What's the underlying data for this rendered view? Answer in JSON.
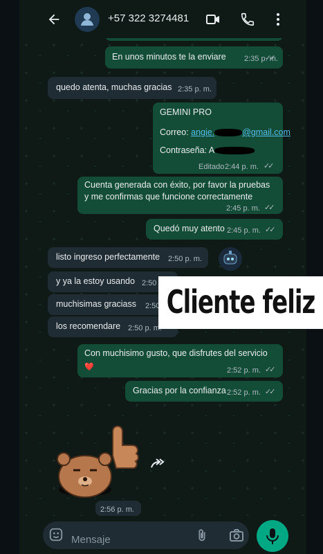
{
  "header": {
    "contact": "+57 322 3274481"
  },
  "messages": [
    {
      "text": "En unos minutos te la enviare",
      "time": "2:35 p. m."
    },
    {
      "text": "quedo atenta, muchas gracias",
      "time": "2:35 p. m."
    },
    {
      "title": "GEMINI PRO",
      "email_label": "Correo: ",
      "email_value": "angie.",
      "email_suffix": "@gmail.com",
      "password_label": "Contraseña: A",
      "edited": "Editado",
      "time": "2:44 p. m."
    },
    {
      "text": "Cuenta generada con éxito, por favor la pruebas y me confirmas que funcione correctamente",
      "time": "2:45 p. m."
    },
    {
      "text": "Quedó muy atento",
      "time": "2:45 p. m."
    },
    {
      "text": "listo ingreso perfectamente",
      "time": "2:50 p. m."
    },
    {
      "text": "y ya la estoy usando",
      "time": "2:50"
    },
    {
      "text": "muchisimas graciass",
      "time": "2:50"
    },
    {
      "text": "los recomendare",
      "time": "2:50 p. m."
    },
    {
      "text": "Con muchisimo gusto, que disfrutes del servicio",
      "emoji": "❤️",
      "time": "2:52 p. m."
    },
    {
      "text": "Gracias por la confianza",
      "time": "2:52 p. m."
    },
    {
      "time": "2:56 p. m."
    }
  ],
  "overlay_text": "Cliente feliz",
  "composer": {
    "placeholder": "Mensaje"
  },
  "icons": [
    "back-arrow-icon",
    "avatar-icon",
    "video-call-icon",
    "phone-icon",
    "menu-dots-icon",
    "emoji-icon",
    "attach-icon",
    "camera-icon",
    "mic-icon",
    "forward-icon",
    "read-ticks-icon"
  ],
  "colors": {
    "outgoing": "#144d37",
    "incoming": "#202c33",
    "accent": "#00a884",
    "link": "#53bdeb"
  }
}
